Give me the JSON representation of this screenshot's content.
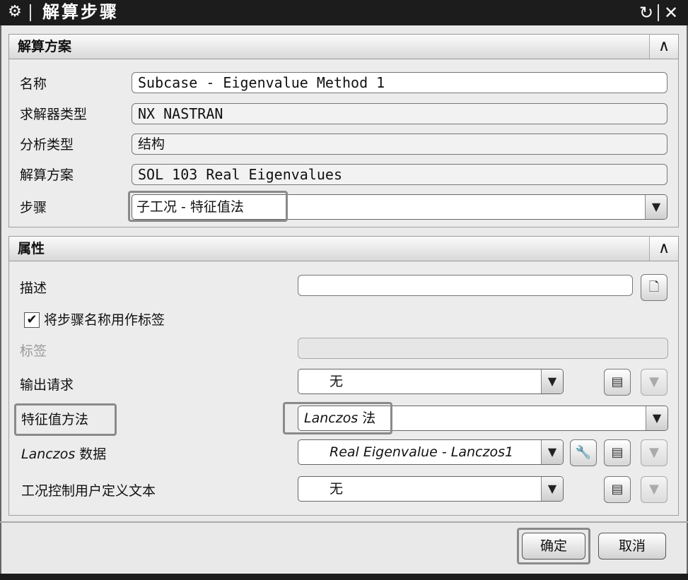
{
  "window": {
    "title": "解算步骤",
    "gear_icon": "⚙",
    "reset_icon": "↻",
    "close_icon": "✕"
  },
  "solution_section": {
    "title": "解算方案",
    "collapse_icon": "∧",
    "name_label": "名称",
    "name_value": "Subcase - Eigenvalue Method 1",
    "solver_type_label": "求解器类型",
    "solver_type_value": "NX NASTRAN",
    "analysis_type_label": "分析类型",
    "analysis_type_value": "结构",
    "solution_label": "解算方案",
    "solution_value": "SOL 103 Real Eigenvalues",
    "step_label": "步骤",
    "step_value": "子工况 - 特征值法"
  },
  "properties_section": {
    "title": "属性",
    "collapse_icon": "∧",
    "description_label": "描述",
    "description_value": "",
    "use_step_name_label": "将步骤名称用作标签",
    "use_step_name_checked": true,
    "tag_label": "标签",
    "tag_value": "",
    "output_request_label": "输出请求",
    "output_request_value": "无",
    "eigen_method_label": "特征值方法",
    "eigen_method_value_italic": "Lanczos",
    "eigen_method_value_suffix": " 法",
    "lanczos_data_label_italic": "Lanczos",
    "lanczos_data_label_suffix": " 数据",
    "lanczos_data_value": "Real Eigenvalue - Lanczos1",
    "case_control_label": "工况控制用户定义文本",
    "case_control_value": "无"
  },
  "footer": {
    "ok_label": "确定",
    "cancel_label": "取消"
  },
  "icons": {
    "dropdown": "▼",
    "page": "🗋",
    "edit": "▤",
    "wrench": "🔧",
    "check": "✔"
  }
}
